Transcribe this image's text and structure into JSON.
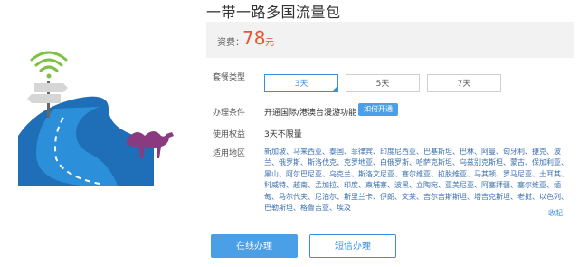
{
  "product": {
    "title": "一带一路多国流量包",
    "price_label": "资费：",
    "price_value": "78",
    "price_unit": "元"
  },
  "package_type": {
    "label": "套餐类型",
    "options": [
      "3天",
      "5天",
      "7天"
    ],
    "selected": "3天"
  },
  "requirements": {
    "label": "办理条件",
    "value": "开通国际/港澳台漫游功能",
    "howto_button": "如何开通"
  },
  "usage_right": {
    "label": "使用权益",
    "value": "3天不限量"
  },
  "regions": {
    "label": "适用地区",
    "text": "新加坡、马来西亚、泰国、菲律宾、印度尼西亚、巴基斯坦、巴林、阿曼、匈牙利、捷克、波兰、俄罗斯、斯洛伐克、克罗地亚、白俄罗斯、哈萨克斯坦、乌兹别克斯坦、蒙古、保加利亚、黑山、阿尔巴尼亚、乌克兰、斯洛文尼亚、塞尔维亚、拉脱维亚、马其顿、罗马尼亚、土耳其、科威特、越南、孟加拉、印度、柬埔寨、波黑、立陶宛、亚美尼亚、阿塞拜疆、塞尔维亚、缅甸、马尔代夫、尼泊尔、斯里兰卡、伊朗、文莱、吉尔吉斯斯坦、塔吉克斯坦、老挝、以色列、巴勒斯坦、格鲁吉亚、埃及",
    "collapse_link": "收起"
  },
  "buttons": {
    "online": "在线办理",
    "sms": "短信办理"
  },
  "colors": {
    "accent": "#4a9fe6",
    "price": "#e8552f",
    "region_text": "#3a6fb0"
  }
}
